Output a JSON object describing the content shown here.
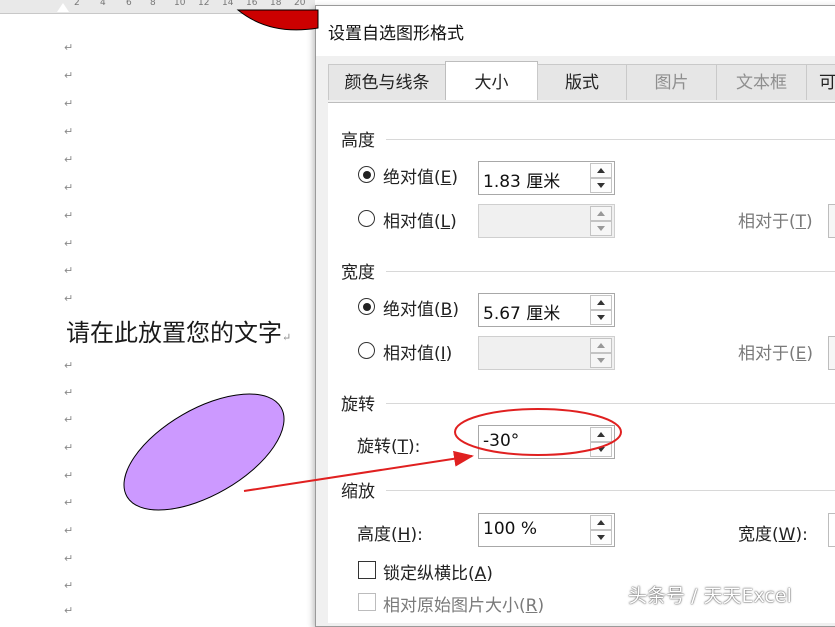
{
  "document": {
    "ruler_ticks": [
      "2",
      "4",
      "6",
      "8",
      "10",
      "12",
      "14",
      "16",
      "18",
      "20"
    ],
    "paragraph_mark": "↵",
    "placeholder_text": "请在此放置您的文字",
    "colors": {
      "ellipse_fill": "#cc99ff",
      "top_shape_fill": "#cc0000",
      "arrow": "#e02020",
      "highlight_circle": "#e02020"
    }
  },
  "dialog": {
    "title": "设置自选图形格式",
    "tabs": [
      {
        "label": "颜色与线条",
        "state": "normal"
      },
      {
        "label": "大小",
        "state": "active"
      },
      {
        "label": "版式",
        "state": "normal"
      },
      {
        "label": "图片",
        "state": "disabled"
      },
      {
        "label": "文本框",
        "state": "disabled"
      },
      {
        "label": "可",
        "state": "normal"
      }
    ],
    "height": {
      "section_label": "高度",
      "absolute_label": "绝对值(",
      "absolute_key": "E",
      "absolute_value": "1.83 厘米",
      "relative_label": "相对值(",
      "relative_key": "L",
      "relative_to_label": "相对于(",
      "relative_to_key": "T"
    },
    "width": {
      "section_label": "宽度",
      "absolute_label": "绝对值(",
      "absolute_key": "B",
      "absolute_value": "5.67 厘米",
      "relative_label": "相对值(",
      "relative_key": "I",
      "relative_to_label": "相对于(",
      "relative_to_key": "E"
    },
    "rotation": {
      "section_label": "旋转",
      "field_label": "旋转(",
      "field_key": "T",
      "value": "-30°"
    },
    "scale": {
      "section_label": "缩放",
      "height_label": "高度(",
      "height_key": "H",
      "height_value": "100 %",
      "width_label": "宽度(",
      "width_key": "W",
      "lock_aspect_label": "锁定纵横比(",
      "lock_aspect_key": "A",
      "relative_original_label": "相对原始图片大小(",
      "relative_original_key": "R"
    },
    "close_paren": ")",
    "colon": ":"
  },
  "watermark": "头条号 / 天天Excel"
}
